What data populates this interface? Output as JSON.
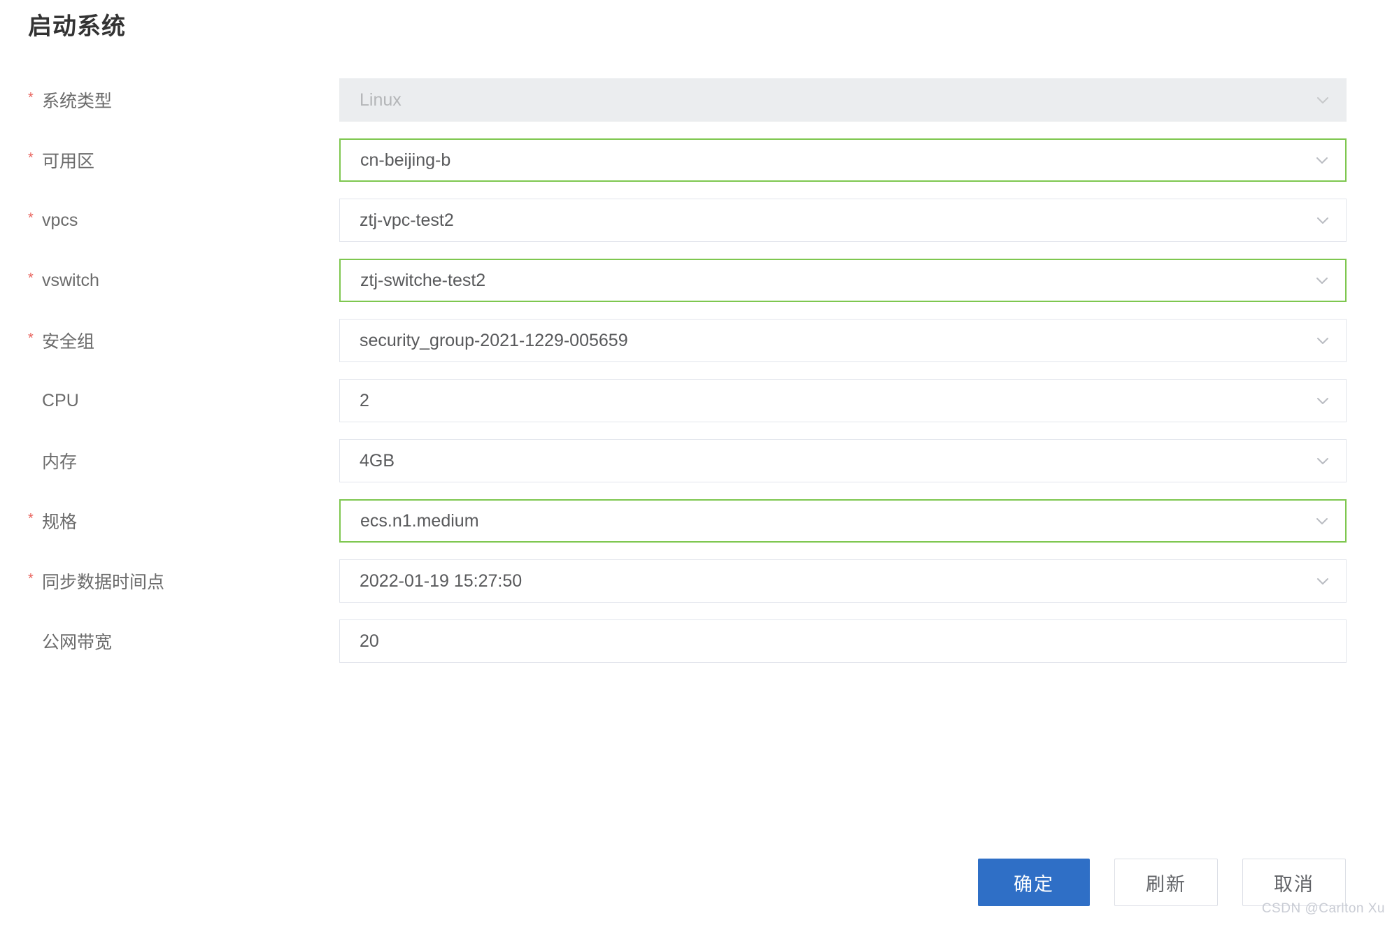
{
  "page": {
    "title": "启动系统"
  },
  "form": {
    "rows": [
      {
        "label": "系统类型",
        "required": true,
        "value": "Linux",
        "state": "disabled",
        "has_chevron": true,
        "icon": "chevron-down-icon",
        "name": "system-type"
      },
      {
        "label": "可用区",
        "required": true,
        "value": "cn-beijing-b",
        "state": "focused",
        "has_chevron": true,
        "icon": "chevron-down-icon",
        "name": "availability-zone"
      },
      {
        "label": "vpcs",
        "required": true,
        "value": "ztj-vpc-test2",
        "state": "normal",
        "has_chevron": true,
        "icon": "chevron-down-icon",
        "name": "vpcs"
      },
      {
        "label": "vswitch",
        "required": true,
        "value": "ztj-switche-test2",
        "state": "focused",
        "has_chevron": true,
        "icon": "chevron-down-icon",
        "name": "vswitch"
      },
      {
        "label": "安全组",
        "required": true,
        "value": "security_group-2021-1229-005659",
        "state": "normal",
        "has_chevron": true,
        "icon": "chevron-down-icon",
        "name": "security-group"
      },
      {
        "label": "CPU",
        "required": false,
        "value": "2",
        "state": "normal",
        "has_chevron": true,
        "icon": "chevron-down-icon",
        "name": "cpu"
      },
      {
        "label": "内存",
        "required": false,
        "value": "4GB",
        "state": "normal",
        "has_chevron": true,
        "icon": "chevron-down-icon",
        "name": "memory"
      },
      {
        "label": "规格",
        "required": true,
        "value": "ecs.n1.medium",
        "state": "focused",
        "has_chevron": true,
        "icon": "chevron-down-icon",
        "name": "instance-type"
      },
      {
        "label": "同步数据时间点",
        "required": true,
        "value": "2022-01-19 15:27:50",
        "state": "normal",
        "has_chevron": true,
        "icon": "chevron-down-icon",
        "name": "sync-data-time"
      },
      {
        "label": "公网带宽",
        "required": false,
        "value": "20",
        "state": "normal",
        "has_chevron": false,
        "icon": "",
        "name": "public-bandwidth"
      }
    ]
  },
  "actions": {
    "confirm_label": "确定",
    "refresh_label": "刷新",
    "cancel_label": "取消"
  },
  "watermark": {
    "text": "CSDN @Carlton Xu"
  },
  "colors": {
    "primary_blue": "#2f6fc6",
    "focus_green": "#7ec74f",
    "required_red": "#e8615b",
    "disabled_bg": "#ebedef",
    "border_gray": "#e2e5ec",
    "label_gray": "#6b6b6b",
    "value_gray": "#58595b",
    "watermark_gray": "#c9ccd4"
  }
}
